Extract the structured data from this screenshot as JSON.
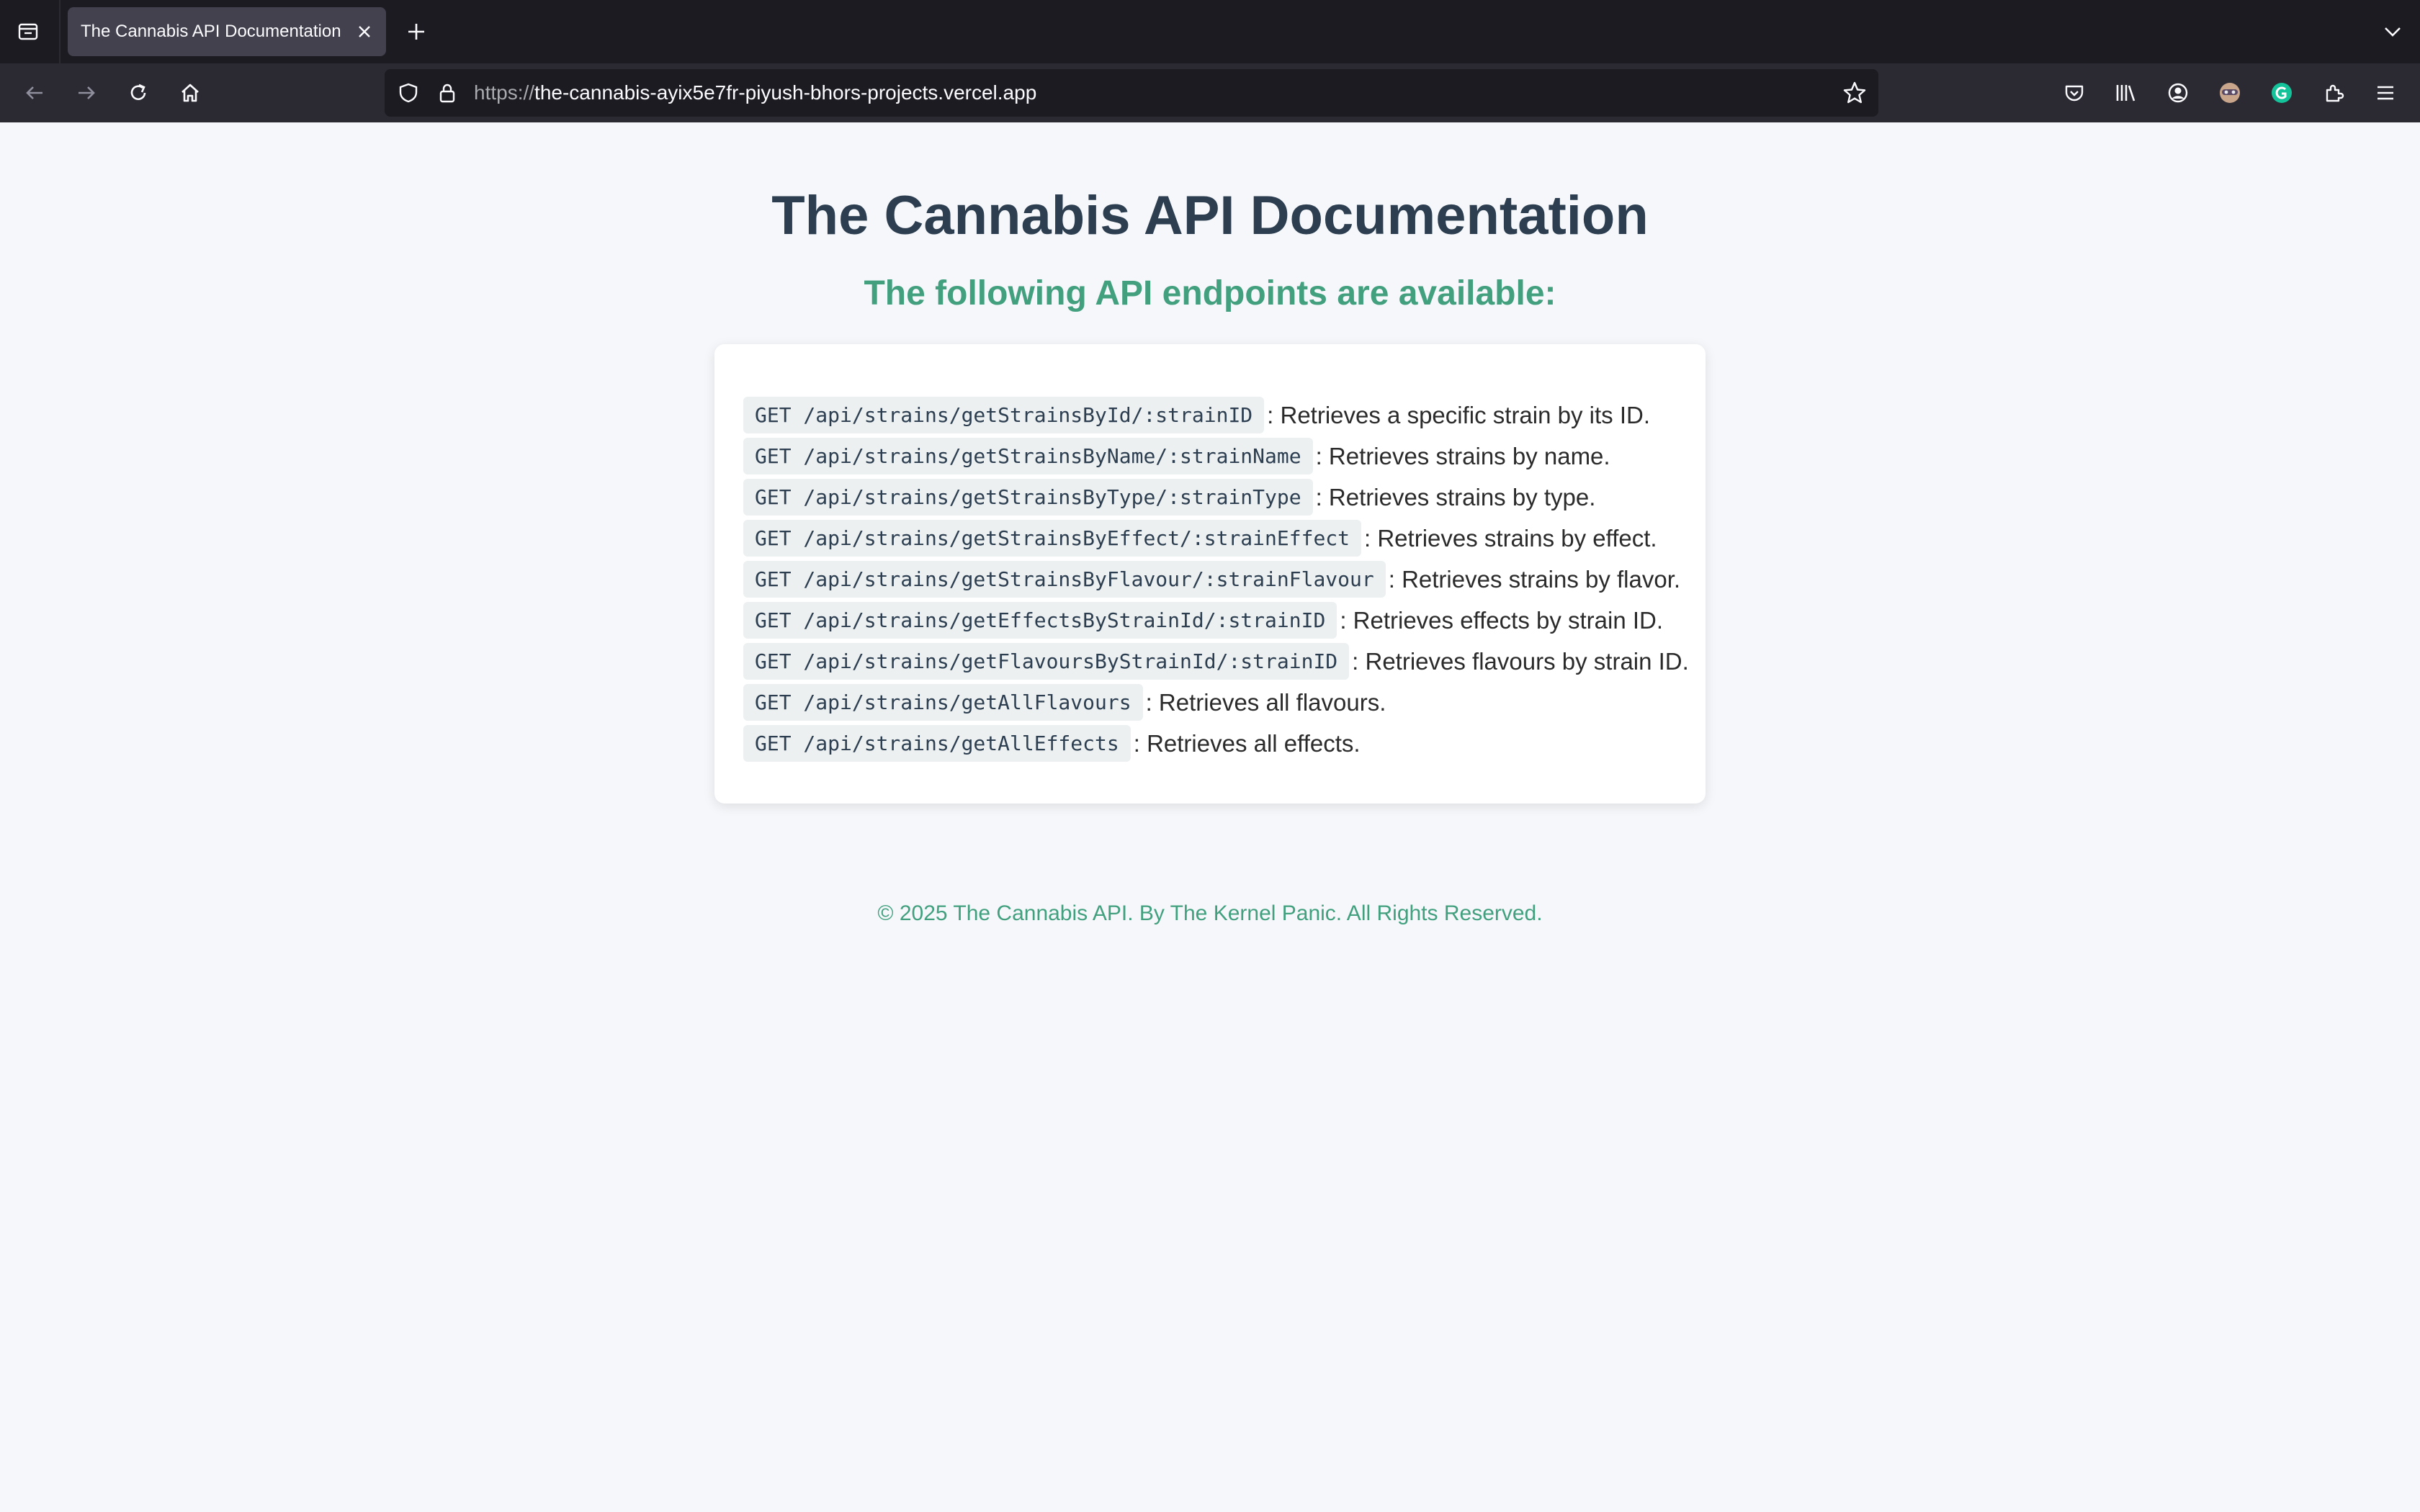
{
  "browser": {
    "tab": {
      "title": "The Cannabis API Documentation"
    },
    "url": {
      "scheme": "https://",
      "host": "the-cannabis-ayix5e7fr-piyush-bhors-projects.vercel.app"
    },
    "icons": {
      "tab_list": "tab-list-icon",
      "close": "close-icon",
      "new_tab": "plus-icon",
      "overflow": "chevron-down-icon",
      "back": "back-arrow-icon",
      "forward": "forward-arrow-icon",
      "reload": "reload-icon",
      "home": "home-icon",
      "tracking": "shield-icon",
      "lock": "lock-icon",
      "bookmark": "star-icon",
      "pocket": "pocket-icon",
      "library": "library-icon",
      "account": "account-icon",
      "extension_a": "masked-face-extension-icon",
      "extension_b": "grammarly-icon",
      "extensions": "puzzle-icon",
      "menu": "hamburger-menu-icon"
    },
    "colors": {
      "tabbar": "#1c1b22",
      "toolbar": "#2b2a33",
      "active_tab": "#42414d",
      "grammarly": "#15c39a"
    }
  },
  "page": {
    "title": "The Cannabis API Documentation",
    "subtitle": "The following API endpoints are available:",
    "endpoints": [
      {
        "code": "GET /api/strains/getStrainsById/:strainID",
        "description": ": Retrieves a specific strain by its ID."
      },
      {
        "code": "GET /api/strains/getStrainsByName/:strainName",
        "description": ": Retrieves strains by name."
      },
      {
        "code": "GET /api/strains/getStrainsByType/:strainType",
        "description": ": Retrieves strains by type."
      },
      {
        "code": "GET /api/strains/getStrainsByEffect/:strainEffect",
        "description": ": Retrieves strains by effect."
      },
      {
        "code": "GET /api/strains/getStrainsByFlavour/:strainFlavour",
        "description": ": Retrieves strains by flavor."
      },
      {
        "code": "GET /api/strains/getEffectsByStrainId/:strainID",
        "description": ": Retrieves effects by strain ID."
      },
      {
        "code": "GET /api/strains/getFlavoursByStrainId/:strainID",
        "description": ": Retrieves flavours by strain ID."
      },
      {
        "code": "GET /api/strains/getAllFlavours",
        "description": ": Retrieves all flavours."
      },
      {
        "code": "GET /api/strains/getAllEffects",
        "description": ": Retrieves all effects."
      }
    ],
    "footer": "© 2025 The Cannabis API. By The Kernel Panic. All Rights Reserved.",
    "colors": {
      "title": "#2c3e50",
      "accent": "#42a07f",
      "background": "#f5f7fa",
      "code_bg": "#ecf0f1"
    }
  }
}
